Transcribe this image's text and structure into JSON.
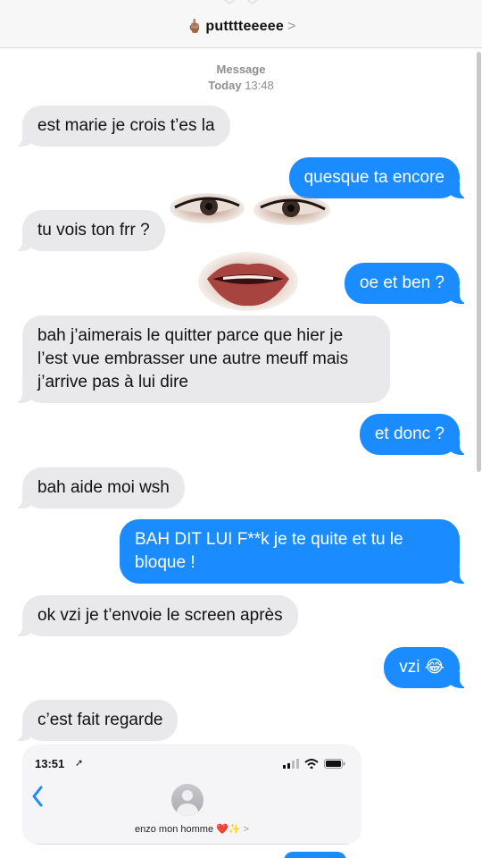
{
  "header": {
    "contact_emoji": "🖕🏽",
    "contact_name": "putttteeeee",
    "chevron": ">"
  },
  "timestamp": {
    "label": "Message",
    "day": "Today",
    "time": "13:48"
  },
  "messages": [
    {
      "dir": "in",
      "text": "est marie je crois t’es la"
    },
    {
      "dir": "out",
      "text": "quesque ta encore"
    },
    {
      "dir": "in",
      "text": "tu vois ton frr ?"
    },
    {
      "dir": "out",
      "text": "oe et ben ?"
    },
    {
      "dir": "in",
      "text": "bah j’aimerais le quitter parce que hier je l’est vue embrasser une autre meuff mais j’arrive pas à lui dire"
    },
    {
      "dir": "out",
      "text": "et donc ?"
    },
    {
      "dir": "in",
      "text": "bah aide moi wsh"
    },
    {
      "dir": "out",
      "text": "BAH DIT LUI F**k je te quite  et tu le bloque !"
    },
    {
      "dir": "in",
      "text": "ok vzi je t’envoie le screen après"
    },
    {
      "dir": "out",
      "text": "vzi 😂"
    },
    {
      "dir": "in",
      "text": "c’est fait regarde"
    }
  ],
  "screenshot": {
    "time": "13:51",
    "contact_name": "enzo mon homme",
    "contact_emojis": "❤️✨",
    "chevron": ">"
  },
  "colors": {
    "sent": "#1a8cff",
    "received": "#e9e9eb",
    "header": "#f7f7f7"
  }
}
